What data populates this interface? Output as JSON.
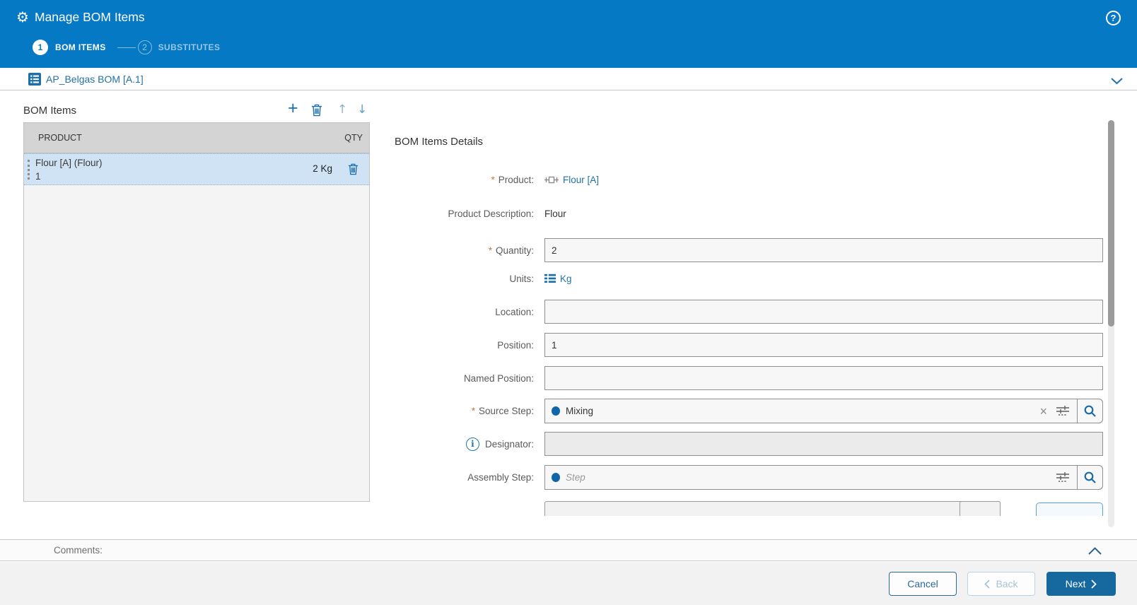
{
  "header": {
    "title": "Manage BOM Items",
    "steps": [
      {
        "number": "1",
        "label": "BOM ITEMS",
        "active": true
      },
      {
        "number": "2",
        "label": "SUBSTITUTES",
        "active": false
      }
    ]
  },
  "icons": {
    "gear": "⚙",
    "help": "?",
    "plus": "+",
    "up_arrow": "↑",
    "down_arrow": "↓",
    "clear": "×",
    "info": "i"
  },
  "bom_bar": {
    "title": "AP_Belgas BOM [A.1]"
  },
  "bom_panel": {
    "title": "BOM Items",
    "table": {
      "columns": [
        "PRODUCT",
        "QTY"
      ],
      "rows": [
        {
          "product": "Flour [A] (Flour)",
          "position": "1",
          "qty": "2 Kg"
        }
      ]
    }
  },
  "details": {
    "title": "BOM Items Details",
    "product": {
      "required": "*",
      "label": "Product:",
      "value": "Flour [A]"
    },
    "product_description": {
      "label": "Product Description:",
      "value": "Flour"
    },
    "quantity": {
      "required": "*",
      "label": "Quantity:",
      "value": "2"
    },
    "units": {
      "label": "Units:",
      "value": "Kg"
    },
    "location": {
      "label": "Location:",
      "value": ""
    },
    "position": {
      "label": "Position:",
      "value": "1"
    },
    "named_position": {
      "label": "Named Position:",
      "value": ""
    },
    "source_step": {
      "required": "*",
      "label": "Source Step:",
      "value": "Mixing"
    },
    "designator": {
      "label": "Designator:",
      "value": ""
    },
    "assembly_step": {
      "label": "Assembly Step:",
      "placeholder": "Step"
    }
  },
  "comments": {
    "label": "Comments:"
  },
  "footer": {
    "cancel": "Cancel",
    "back": "Back",
    "next": "Next"
  },
  "colors": {
    "header_blue": "#0579c4",
    "accent_blue": "#1b6fad",
    "link_blue": "#2272a8",
    "selected_row": "#cfe3f4",
    "table_header_gray": "#d4d4d4",
    "next_button_blue": "#16699f",
    "required_asterisk": "#bf7a3f"
  }
}
